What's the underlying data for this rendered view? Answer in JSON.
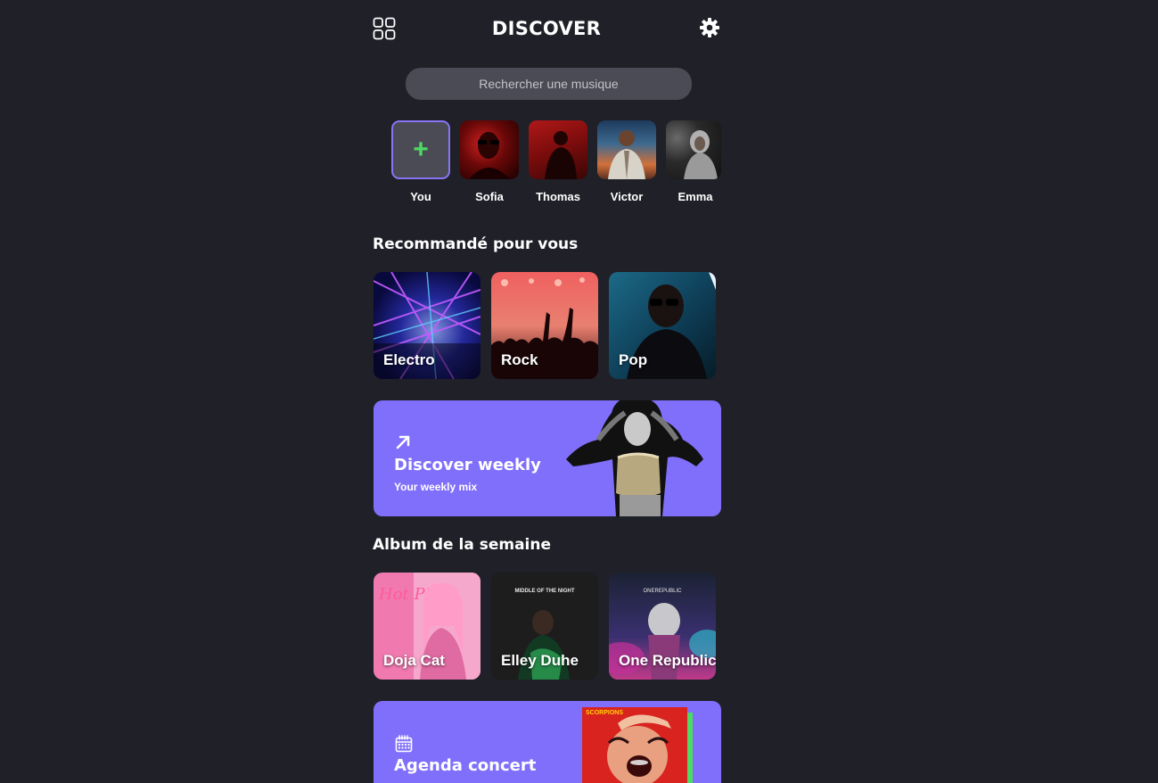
{
  "header": {
    "title": "DISCOVER",
    "menu_icon": "grid-icon",
    "settings_icon": "gear-icon"
  },
  "search": {
    "placeholder": "Rechercher une musique"
  },
  "stories": [
    {
      "name": "You",
      "icon": "plus-icon"
    },
    {
      "name": "Sofia"
    },
    {
      "name": "Thomas"
    },
    {
      "name": "Victor"
    },
    {
      "name": "Emma"
    }
  ],
  "recommended": {
    "title": "Recommandé pour vous",
    "genres": [
      {
        "label": "Electro"
      },
      {
        "label": "Rock"
      },
      {
        "label": "Pop"
      }
    ]
  },
  "discover_weekly": {
    "icon": "arrow-up-right-icon",
    "title": "Discover weekly",
    "subtitle": "Your weekly mix"
  },
  "albums": {
    "title": "Album de la semaine",
    "items": [
      {
        "label": "Doja Cat",
        "cover_text": "Hot Pink"
      },
      {
        "label": "Elley Duhe",
        "cover_text": "MIDDLE OF THE NIGHT"
      },
      {
        "label": "One Republic",
        "cover_text": "ONEREPUBLIC"
      }
    ]
  },
  "agenda": {
    "icon": "calendar-icon",
    "title": "Agenda concert",
    "cover_text": "SCORPIONS"
  },
  "colors": {
    "background": "#1f2028",
    "accent": "#806ffb",
    "plus_green": "#4cd964",
    "search_bg": "#4a4b54"
  }
}
